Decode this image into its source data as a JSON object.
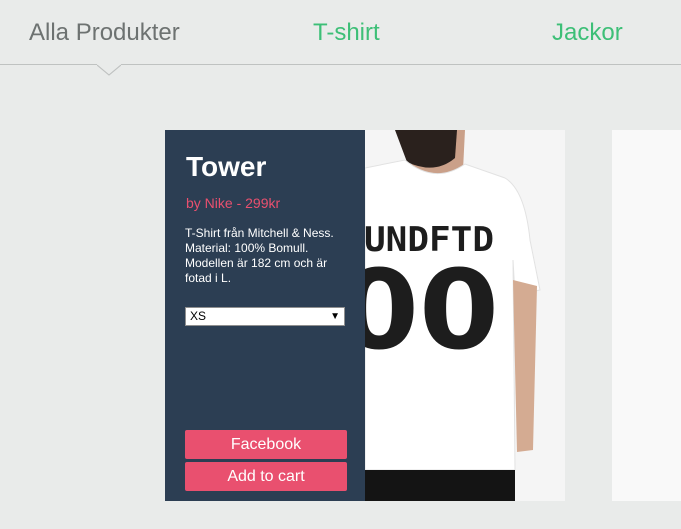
{
  "tabs": [
    {
      "label": "Alla Produkter",
      "active": true
    },
    {
      "label": "T-shirt",
      "active": false
    },
    {
      "label": "Jackor",
      "active": false
    }
  ],
  "product": {
    "name": "Tower",
    "brand_price": "by Nike - 299kr",
    "description": "T-Shirt från Mitchell & Ness. Material: 100% Bomull. Modellen är 182 cm och är fotad i L.",
    "size_selected": "XS",
    "facebook_label": "Facebook",
    "cart_label": "Add to cart",
    "shirt_print": "UNDFTD",
    "shirt_number": "00"
  },
  "colors": {
    "accent_green": "#3dbf77",
    "accent_pink": "#e9506f",
    "panel_navy": "#2c3e53"
  }
}
